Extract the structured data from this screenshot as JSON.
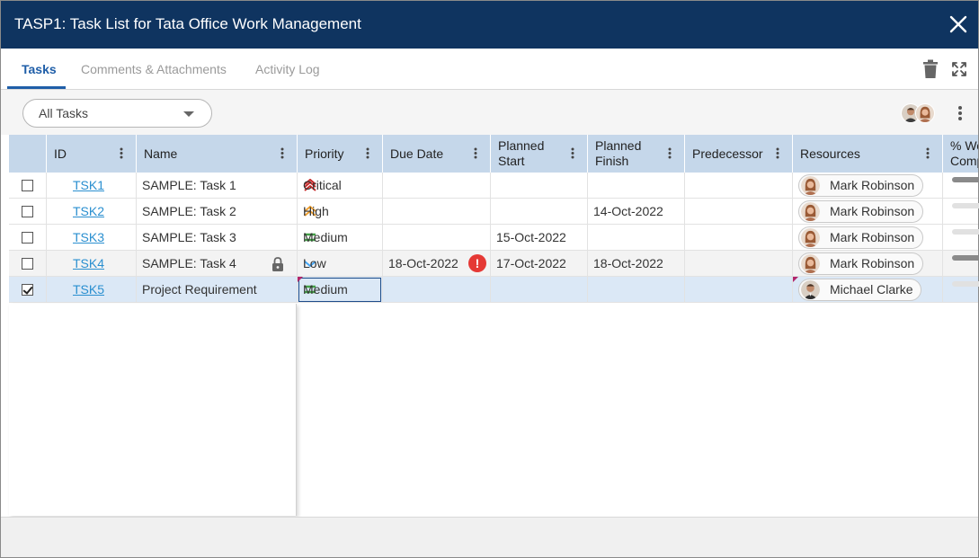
{
  "dialog": {
    "title": "TASP1: Task List for Tata Office Work Management"
  },
  "tabs": [
    {
      "label": "Tasks"
    },
    {
      "label": "Comments & Attachments"
    },
    {
      "label": "Activity Log"
    }
  ],
  "toolbar": {
    "filter_value": "All Tasks"
  },
  "columns": {
    "id": "ID",
    "name": "Name",
    "priority": "Priority",
    "due_date": "Due Date",
    "planned_start_1": "Planned",
    "planned_start_2": "Start",
    "planned_finish_1": "Planned",
    "planned_finish_2": "Finish",
    "predecessor": "Predecessor",
    "resources": "Resources",
    "pct_1": "% Wo",
    "pct_2": "Comp"
  },
  "rows": [
    {
      "id": "TSK1",
      "name": "SAMPLE: Task 1",
      "priority": "Critical",
      "due": "",
      "start": "",
      "finish": "",
      "pred": "",
      "resource": "Mark Robinson",
      "checked": false
    },
    {
      "id": "TSK2",
      "name": "SAMPLE: Task 2",
      "priority": "High",
      "due": "",
      "start": "",
      "finish": "14-Oct-2022",
      "pred": "",
      "resource": "Mark Robinson",
      "checked": false
    },
    {
      "id": "TSK3",
      "name": "SAMPLE: Task 3",
      "priority": "Medium",
      "due": "",
      "start": "15-Oct-2022",
      "finish": "",
      "pred": "",
      "resource": "Mark Robinson",
      "checked": false
    },
    {
      "id": "TSK4",
      "name": "SAMPLE: Task 4",
      "priority": "Low",
      "due": "18-Oct-2022",
      "due_warning": "!",
      "start": "17-Oct-2022",
      "finish": "18-Oct-2022",
      "pred": "",
      "resource": "Mark Robinson",
      "checked": false,
      "locked": true
    },
    {
      "id": "TSK5",
      "name": "Project Requirement",
      "priority": "Medium",
      "due": "",
      "start": "",
      "finish": "",
      "pred": "",
      "resource": "Michael Clarke",
      "checked": true
    }
  ],
  "colors": {
    "titlebar": "#0f3460",
    "accent": "#1f5ea8",
    "header": "#c5d7ea",
    "link": "#2a8fd0",
    "critical": "#c62828",
    "high": "#f0a030",
    "medium": "#43a047",
    "low": "#42a5f5",
    "warning": "#e53935"
  }
}
